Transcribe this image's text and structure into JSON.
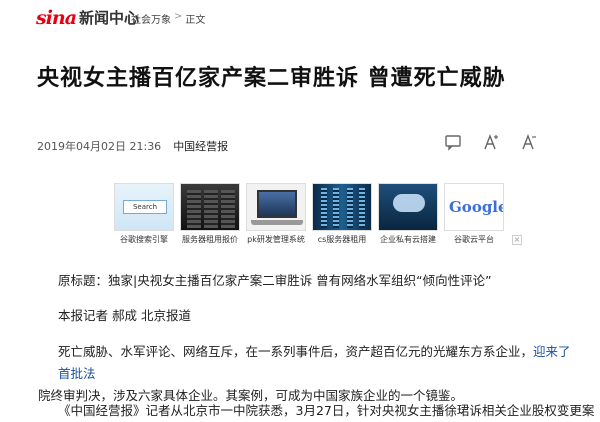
{
  "header": {
    "logo_brand": "sina",
    "logo_section": "新闻中心",
    "breadcrumb": [
      "社会万象",
      "正文"
    ],
    "breadcrumb_sep": ">"
  },
  "article": {
    "title": "央视女主播百亿家产案二审胜诉 曾遭死亡威胁",
    "datetime": "2019年04月02日 21:36",
    "source": "中国经营报"
  },
  "tools": {
    "comment_icon": "comment-icon",
    "font_increase_icon": "font-increase-icon",
    "font_decrease_icon": "font-decrease-icon"
  },
  "ads": {
    "items": [
      {
        "label": "谷歌搜索引擎",
        "icon": "search-thumb",
        "search_text": "Search"
      },
      {
        "label": "服务器租用报价",
        "icon": "server-thumb"
      },
      {
        "label": "pk研发管理系统",
        "icon": "laptop-thumb"
      },
      {
        "label": "cs服务器租用",
        "icon": "datacenter-thumb"
      },
      {
        "label": "企业私有云搭建",
        "icon": "cloud-thumb"
      },
      {
        "label": "谷歌云平台",
        "icon": "google-thumb",
        "google_text": "Google"
      }
    ],
    "more_icon": "ad-more-icon"
  },
  "body": {
    "source_line": "原标题：独家|央视女主播百亿家产案二审胜诉 曾有网络水军组织“倾向性评论”",
    "reporter_line": "本报记者 郝成 北京报道",
    "para1_a": "死亡威胁、水军评论、网络互斥，在一系列事件后，资产超百亿元的光耀东方系企业，",
    "para1_link": "迎来了首批法",
    "para1_b": "院终审判决，涉及六家具体企业。其案例，可成为中国家族企业的一个镜鉴。",
    "para2": "《中国经营报》记者从北京市一中院获悉，3月27日，针对央视女主播徐珺诉相关企业股权变更案"
  }
}
